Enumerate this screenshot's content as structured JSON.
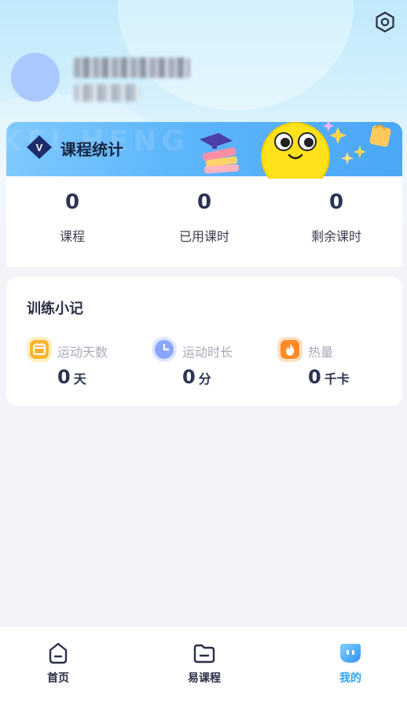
{
  "header": {
    "settings_icon": "settings-hexagon-icon",
    "avatar_icon": "avatar"
  },
  "course_stats": {
    "title": "课程统计",
    "watermark": "KEI HENG",
    "badge_icon": "vip-badge-icon",
    "items": [
      {
        "value": "0",
        "label": "课程"
      },
      {
        "value": "0",
        "label": "已用课时"
      },
      {
        "value": "0",
        "label": "剩余课时"
      }
    ]
  },
  "training": {
    "title": "训练小记",
    "metrics": [
      {
        "label": "运动天数",
        "value": "0",
        "unit": "天",
        "icon": "calendar-icon",
        "color": "#f9b52f"
      },
      {
        "label": "运动时长",
        "value": "0",
        "unit": "分",
        "icon": "clock-icon",
        "color": "#8aa6ff"
      },
      {
        "label": "热量",
        "value": "0",
        "unit": "千卡",
        "icon": "flame-icon",
        "color": "#ff9a3a"
      }
    ]
  },
  "tabbar": {
    "tabs": [
      {
        "label": "首页",
        "icon": "home-icon",
        "active": false
      },
      {
        "label": "易课程",
        "icon": "folder-icon",
        "active": false
      },
      {
        "label": "我的",
        "icon": "profile-bubble-icon",
        "active": true
      }
    ],
    "active_color": "#29a3f5"
  }
}
